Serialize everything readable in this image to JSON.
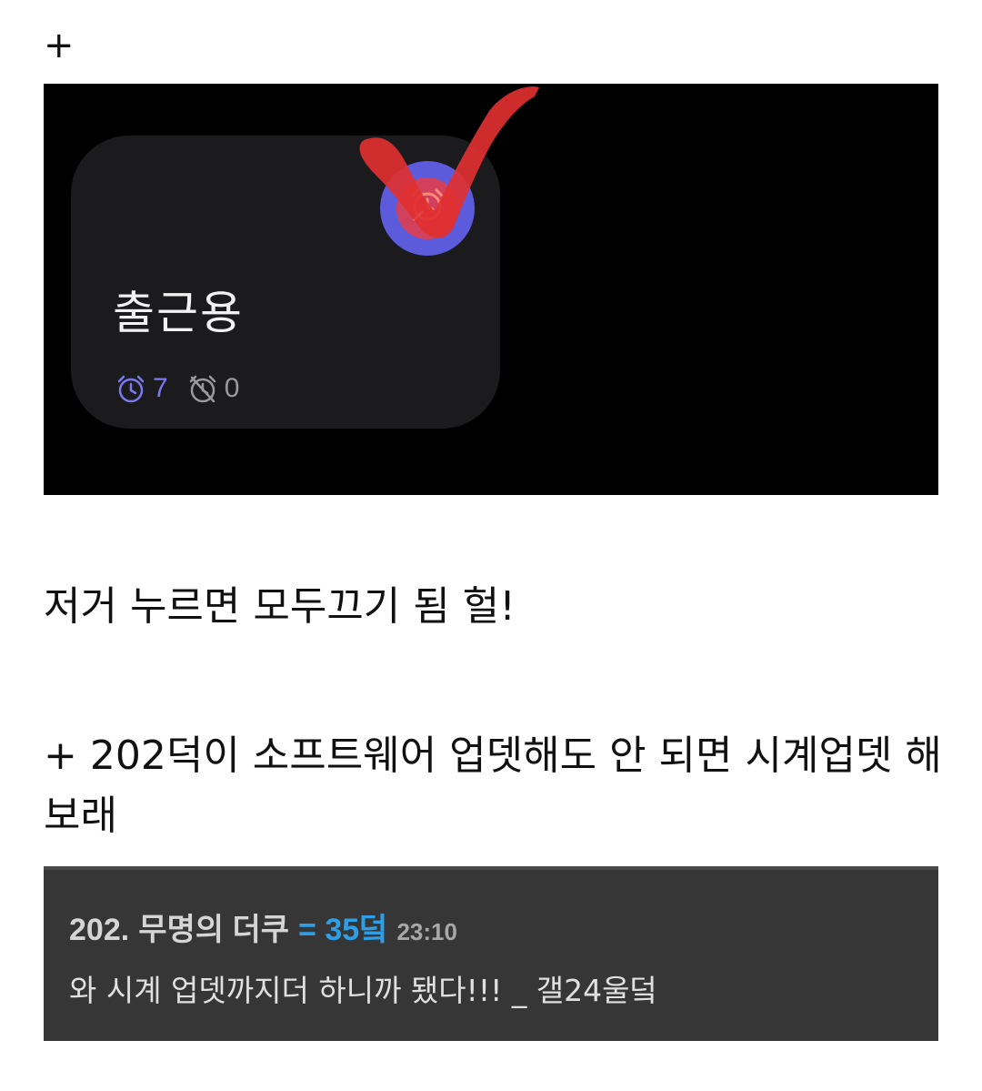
{
  "header": {
    "plus": "+"
  },
  "screenshot": {
    "widget": {
      "title": "출근용",
      "active_icon": "alarm-clock-icon",
      "active_count": "7",
      "inactive_icon": "alarm-off-icon",
      "inactive_count": "0",
      "toggle_icon": "alarm-clock-icon",
      "colors": {
        "accent": "#5b5bdc",
        "card": "#1b1b1d",
        "annotation": "#e03030"
      }
    }
  },
  "captions": {
    "line1": "저거 누르면 모두끄기 됨 헐!",
    "line2": "+ 202덕이 소프트웨어 업뎃해도 안 되면 시계업뎃 해보래"
  },
  "comment": {
    "id": "202.",
    "name": "무명의 더쿠",
    "count": "= 35덬",
    "time": "23:10",
    "body": "와 시계 업뎃까지더 하니까 됐다!!! _ 갤24울덬"
  }
}
